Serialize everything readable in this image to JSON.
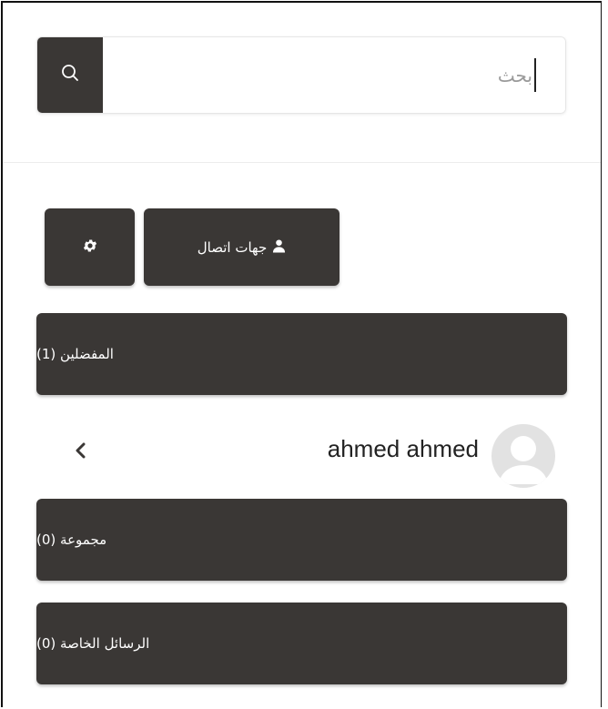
{
  "search": {
    "placeholder": "بحث",
    "icon": "search-icon"
  },
  "toolbar": {
    "contacts_label": "جهات اتصال",
    "contacts_icon": "user-icon",
    "settings_icon": "gear-icon"
  },
  "sections": {
    "favorites_label": "المفضلين (1)",
    "groups_label": "مجموعة (0)",
    "private_messages_label": "الرسائل الخاصة (0)"
  },
  "favorites": [
    {
      "name": "ahmed ahmed",
      "avatar": "default-avatar-icon",
      "action_icon": "chevron-left-icon"
    }
  ],
  "colors": {
    "dark": "#3a3735",
    "light_border": "#e6e6e6",
    "avatar_bg": "#e2e2e2"
  }
}
